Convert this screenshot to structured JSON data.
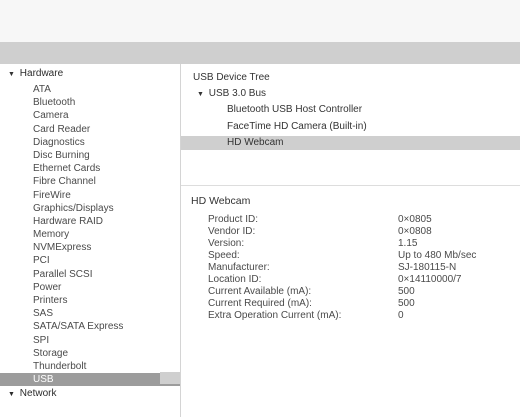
{
  "sidebar": {
    "hardware_label": "Hardware",
    "items": [
      "ATA",
      "Bluetooth",
      "Camera",
      "Card Reader",
      "Diagnostics",
      "Disc Burning",
      "Ethernet Cards",
      "Fibre Channel",
      "FireWire",
      "Graphics/Displays",
      "Hardware RAID",
      "Memory",
      "NVMExpress",
      "PCI",
      "Parallel SCSI",
      "Power",
      "Printers",
      "SAS",
      "SATA/SATA Express",
      "SPI",
      "Storage",
      "Thunderbolt",
      "USB"
    ],
    "selected_index": 22,
    "network_label": "Network"
  },
  "tree": {
    "title": "USB Device Tree",
    "bus": "USB 3.0 Bus",
    "children": [
      "Bluetooth USB Host Controller",
      "FaceTime HD Camera (Built-in)",
      "HD Webcam"
    ],
    "selected_index": 2
  },
  "detail": {
    "title": "HD Webcam",
    "properties": [
      {
        "key": "Product ID:",
        "value": "0×0805"
      },
      {
        "key": "Vendor ID:",
        "value": "0×0808"
      },
      {
        "key": "Version:",
        "value": "1.15"
      },
      {
        "key": "Speed:",
        "value": "Up to 480 Mb/sec"
      },
      {
        "key": "Manufacturer:",
        "value": "SJ-180115-N"
      },
      {
        "key": "Location ID:",
        "value": "0×14110000/7"
      },
      {
        "key": "Current Available (mA):",
        "value": "500"
      },
      {
        "key": "Current Required (mA):",
        "value": "500"
      },
      {
        "key": "Extra Operation Current (mA):",
        "value": "0"
      }
    ]
  }
}
